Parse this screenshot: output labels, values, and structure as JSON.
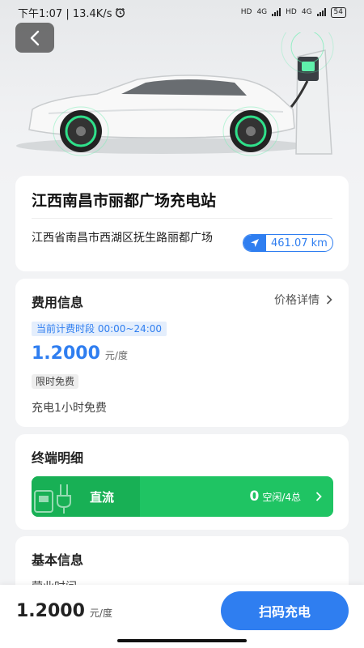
{
  "status_bar": {
    "time_speed": "下午1:07 | 13.4K/s",
    "alarm_icon": "alarm-icon",
    "hd1": "HD",
    "net1": "4G",
    "hd2": "HD",
    "net2": "4G",
    "battery": "54"
  },
  "station": {
    "name": "江西南昌市丽都广场充电站",
    "address": "江西省南昌市西湖区抚生路丽都广场",
    "distance": "461.07 km"
  },
  "fee": {
    "title": "费用信息",
    "price_detail_label": "价格详情",
    "period_label": "当前计费时段 00:00~24:00",
    "price": "1.2000",
    "unit": "元/度",
    "free_tag": "限时免费",
    "free_text": "充电1小时免费"
  },
  "terminal": {
    "title": "终端明细",
    "type": "直流",
    "free_count": "0",
    "status_text": "空闲/4总"
  },
  "basic": {
    "title": "基本信息",
    "partial_text": "营业时间"
  },
  "bottom": {
    "price": "1.2000",
    "unit": "元/度",
    "scan_button": "扫码充电"
  },
  "colors": {
    "accent": "#2f7ef0",
    "terminal_green": "#1fc463",
    "terminal_dark_green": "#18b055"
  }
}
